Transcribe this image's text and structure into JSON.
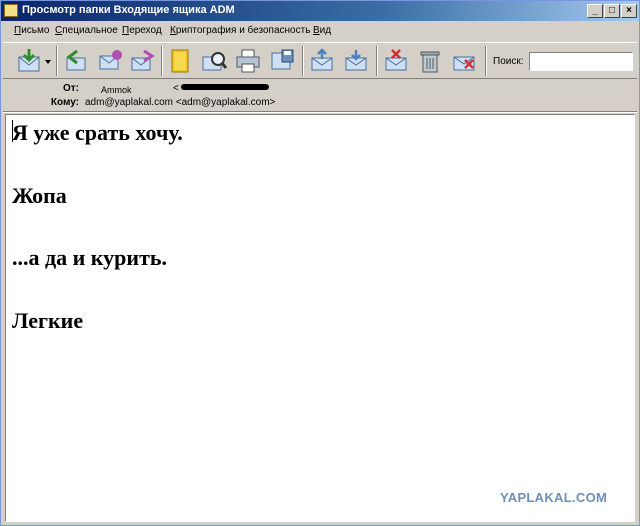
{
  "window": {
    "title": "Просмотр папки Входящие ящика ADM",
    "controls": {
      "minimize": "_",
      "maximize": "□",
      "close": "×"
    }
  },
  "menubar": {
    "items": [
      {
        "label_u": "П",
        "label_rest": "исьмо"
      },
      {
        "label_u": "С",
        "label_rest": "пециальное"
      },
      {
        "label_u": "П",
        "label_rest": "ереход"
      },
      {
        "label_u": "К",
        "label_rest": "риптография и безопасность"
      },
      {
        "label_u": "В",
        "label_rest": "ид"
      }
    ]
  },
  "toolbar": {
    "icons": [
      "get-mail-icon",
      "dropdown-arrow-icon",
      "reply-icon",
      "reply-all-icon",
      "forward-icon",
      "address-book-icon",
      "find-icon",
      "print-icon",
      "save-icon",
      "move-icon",
      "copy-icon",
      "delete-icon",
      "trash-icon",
      "spam-icon"
    ],
    "search_label": "Поиск:",
    "search_value": ""
  },
  "header": {
    "from_label": "От:",
    "from_name": "Ammok",
    "from_bracket": "<",
    "to_label": "Кому:",
    "to_value": "adm@yaplakal.com <adm@yaplakal.com>"
  },
  "message": {
    "lines": [
      "Я уже срать хочу.",
      "Жопа",
      "...а да и курить.",
      "Легкие"
    ]
  },
  "watermark": "YAPLAKAL.COM",
  "colors": {
    "title_start": "#0a246a",
    "title_end": "#a6caf0",
    "chrome": "#d4d0c8",
    "watermark": "#6e8fb5"
  }
}
